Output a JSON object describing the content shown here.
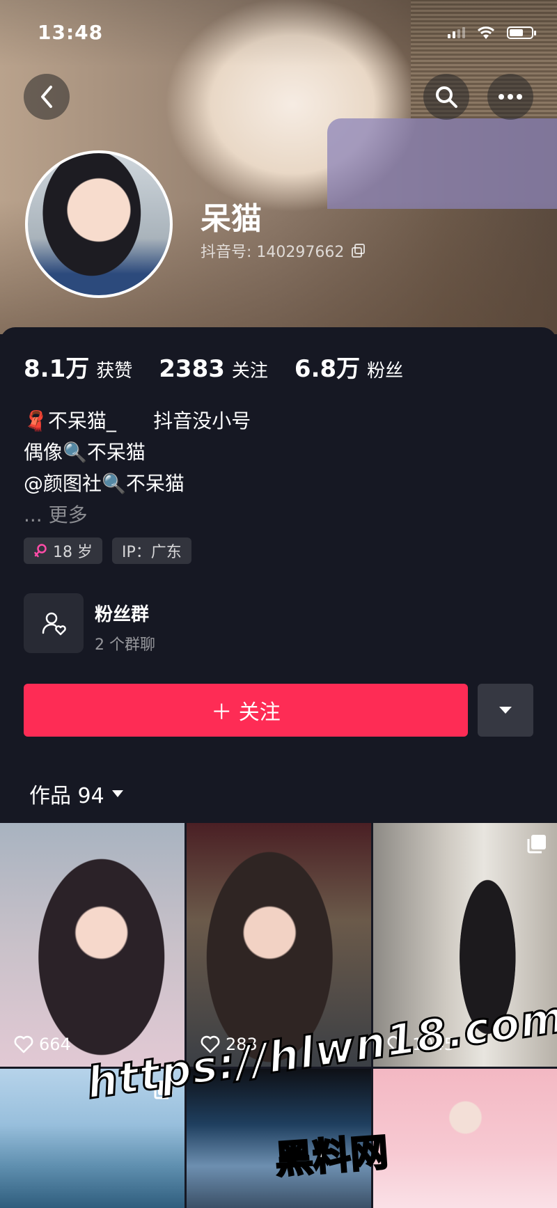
{
  "status_bar": {
    "time": "13:48"
  },
  "profile": {
    "name": "呆猫",
    "douyin_id": "抖音号: 140297662"
  },
  "stats": [
    {
      "value": "8.1万",
      "label": "获赞"
    },
    {
      "value": "2383",
      "label": "关注"
    },
    {
      "value": "6.8万",
      "label": "粉丝"
    }
  ],
  "bio": {
    "line1": "🧣不呆猫_      抖音没小号",
    "line2": "偶像🔍不呆猫",
    "line3": "@颜图社🔍不呆猫",
    "more": "... 更多"
  },
  "tags": {
    "age": "18 岁",
    "ip": "IP：广东"
  },
  "fan_group": {
    "title": "粉丝群",
    "subtitle": "2 个群聊"
  },
  "actions": {
    "follow": "＋ 关注"
  },
  "works_tab": {
    "label": "作品 94"
  },
  "works": [
    {
      "likes": "664",
      "multi": false
    },
    {
      "likes": "283",
      "multi": false
    },
    {
      "likes": "1045",
      "multi": true
    },
    {
      "likes": "",
      "multi": true
    },
    {
      "likes": "",
      "multi": false
    },
    {
      "likes": "",
      "multi": false
    }
  ],
  "watermark": {
    "url": "https://hlwn18.com",
    "text": "黑料网"
  },
  "colors": {
    "accent": "#fe2c55",
    "background": "#161823"
  }
}
